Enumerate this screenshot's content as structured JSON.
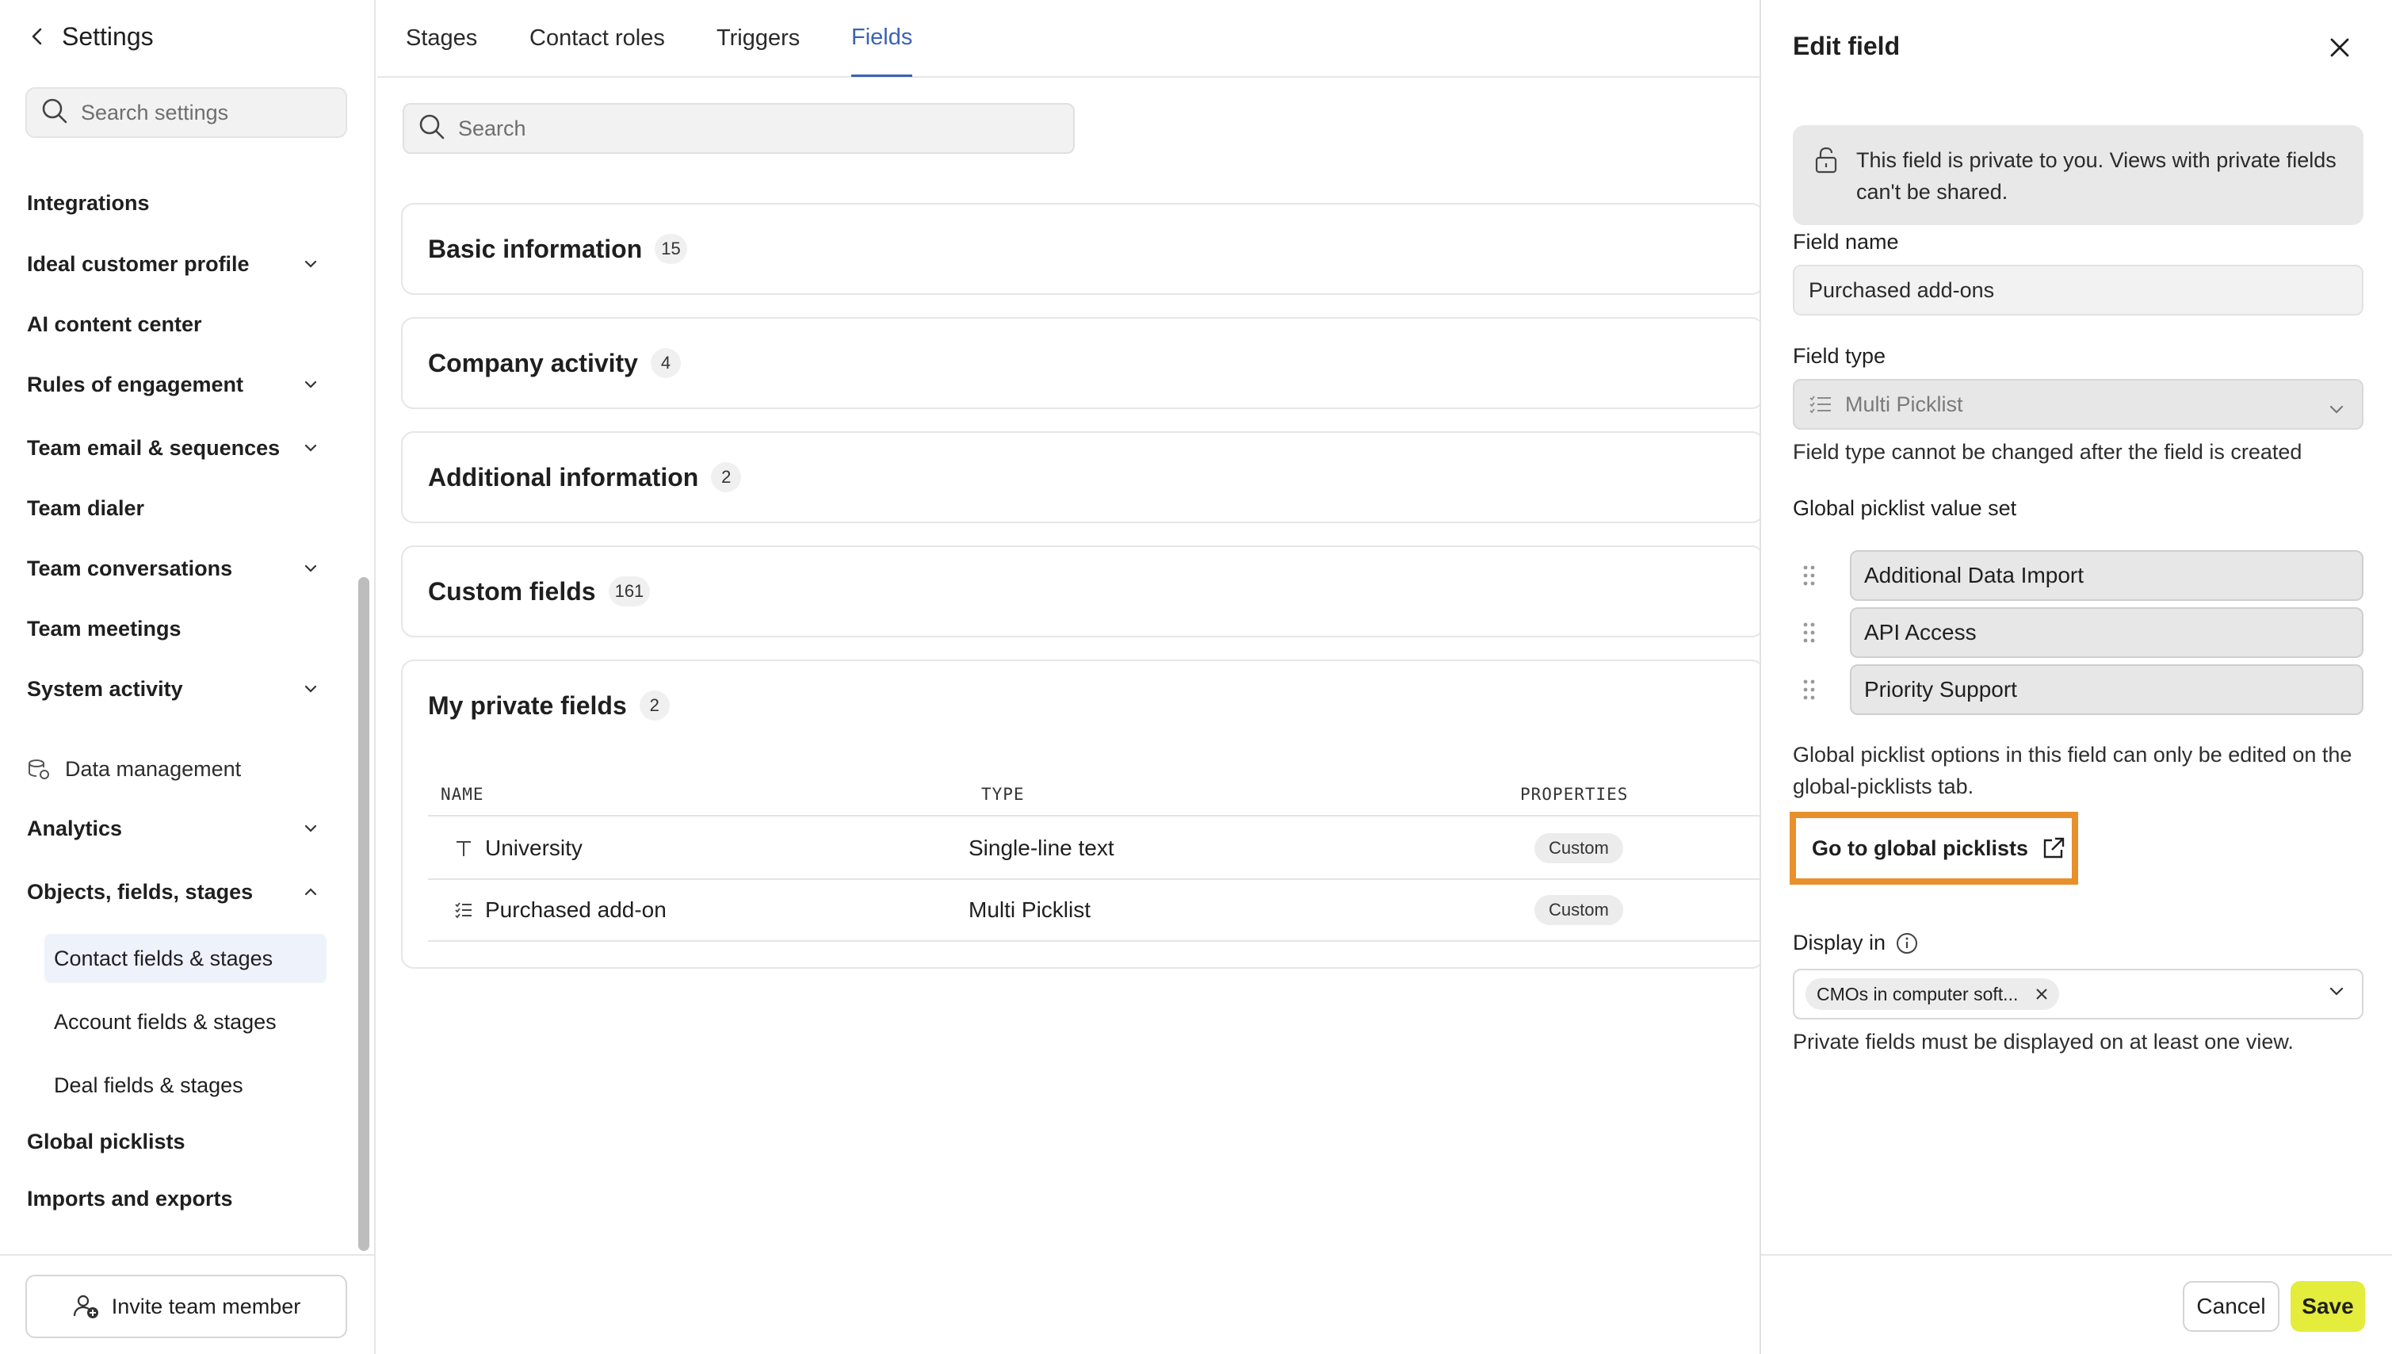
{
  "sidebar": {
    "title": "Settings",
    "search_placeholder": "Search settings",
    "items": [
      {
        "label": "Integrations",
        "has_chevron": false
      },
      {
        "label": "Ideal customer profile",
        "has_chevron": true
      },
      {
        "label": "AI content center",
        "has_chevron": false
      },
      {
        "label": "Rules of engagement",
        "has_chevron": true
      },
      {
        "label": "Team email & sequences",
        "has_chevron": true
      },
      {
        "label": "Team dialer",
        "has_chevron": false
      },
      {
        "label": "Team conversations",
        "has_chevron": true
      },
      {
        "label": "Team meetings",
        "has_chevron": false
      },
      {
        "label": "System activity",
        "has_chevron": true
      }
    ],
    "data_management": "Data management",
    "analytics": "Analytics",
    "objects": "Objects, fields, stages",
    "sub_items": [
      {
        "label": "Contact fields & stages",
        "active": true
      },
      {
        "label": "Account fields & stages",
        "active": false
      },
      {
        "label": "Deal fields & stages",
        "active": false
      }
    ],
    "global_picklists": "Global picklists",
    "imports_exports": "Imports and exports",
    "invite_button": "Invite team member"
  },
  "tabs": [
    {
      "label": "Stages",
      "active": false
    },
    {
      "label": "Contact roles",
      "active": false
    },
    {
      "label": "Triggers",
      "active": false
    },
    {
      "label": "Fields",
      "active": true
    }
  ],
  "main": {
    "search_placeholder": "Search",
    "sections": [
      {
        "title": "Basic information",
        "count": "15"
      },
      {
        "title": "Company activity",
        "count": "4"
      },
      {
        "title": "Additional information",
        "count": "2"
      },
      {
        "title": "Custom fields",
        "count": "161"
      },
      {
        "title": "My private fields",
        "count": "2"
      }
    ],
    "table": {
      "headers": {
        "name": "NAME",
        "type": "TYPE",
        "properties": "PROPERTIES"
      },
      "rows": [
        {
          "name": "University",
          "type": "Single-line text",
          "property": "Custom",
          "icon": "text-icon"
        },
        {
          "name": "Purchased add-on",
          "type": "Multi Picklist",
          "property": "Custom",
          "icon": "list-icon"
        }
      ]
    }
  },
  "panel": {
    "title": "Edit field",
    "private_note": "This field is private to you. Views with private fields can't be shared.",
    "field_name_label": "Field name",
    "field_name_value": "Purchased add-ons",
    "field_type_label": "Field type",
    "field_type_value": "Multi Picklist",
    "field_type_help": "Field type cannot be changed after the field is created",
    "picklist_label": "Global picklist value set",
    "picklist_values": [
      "Additional Data Import",
      "API Access",
      "Priority Support"
    ],
    "picklist_help": "Global picklist options in this field can only be edited on the global-picklists tab.",
    "goto_button": "Go to global picklists",
    "display_in_label": "Display in",
    "display_in_chip": "CMOs in computer soft...",
    "display_in_help": "Private fields must be displayed on at least one view.",
    "cancel_button": "Cancel",
    "save_button": "Save"
  },
  "colors": {
    "accent_blue": "#3a63b4",
    "highlight_orange": "#e8902c",
    "save_yellow": "#e4ec3c",
    "active_nav_bg": "#eef2fb"
  }
}
